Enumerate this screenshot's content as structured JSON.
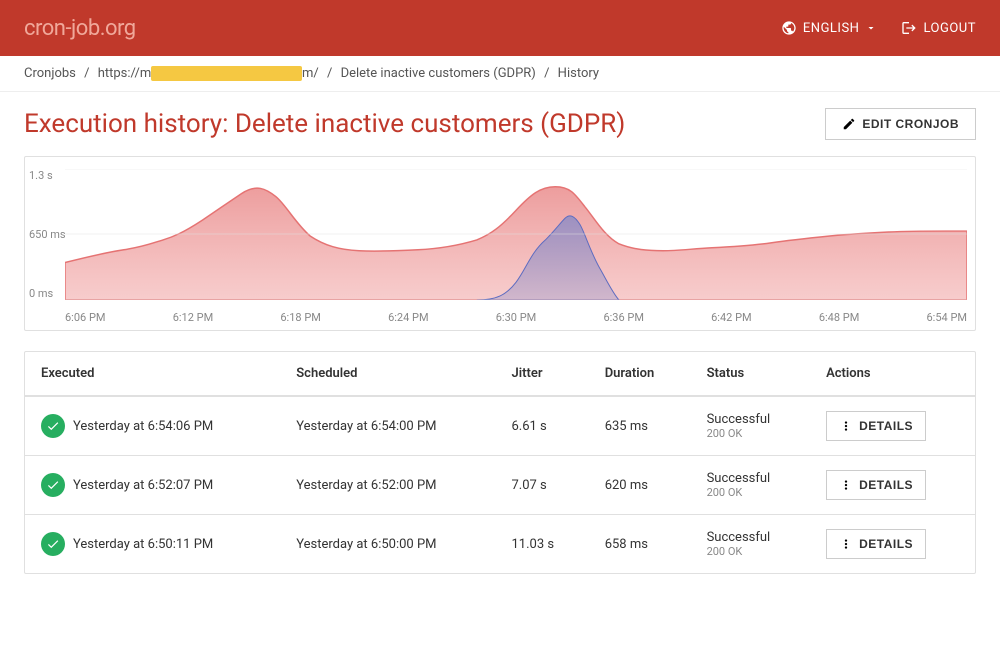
{
  "header": {
    "logo_text": "cron-job",
    "logo_suffix": ".org",
    "lang_label": "ENGLISH",
    "logout_label": "LOGOUT"
  },
  "breadcrumb": {
    "cronjobs": "Cronjobs",
    "url_display": "https://m...m/",
    "job_name": "Delete inactive customers (GDPR)",
    "current": "History"
  },
  "page": {
    "title": "Execution history: Delete inactive customers (GDPR)",
    "edit_btn": "EDIT CRONJOB"
  },
  "chart": {
    "y_labels": [
      "1.3 s",
      "650 ms",
      "0 ms"
    ],
    "x_labels": [
      "6:06 PM",
      "6:12 PM",
      "6:18 PM",
      "6:24 PM",
      "6:30 PM",
      "6:36 PM",
      "6:42 PM",
      "6:48 PM",
      "6:54 PM"
    ]
  },
  "table": {
    "columns": [
      "Executed",
      "Scheduled",
      "Jitter",
      "Duration",
      "Status",
      "Actions"
    ],
    "rows": [
      {
        "executed": "Yesterday at 6:54:06 PM",
        "scheduled": "Yesterday at 6:54:00 PM",
        "jitter": "6.61 s",
        "duration": "635 ms",
        "status": "Successful",
        "status_code": "200 OK",
        "action_label": "DETAILS"
      },
      {
        "executed": "Yesterday at 6:52:07 PM",
        "scheduled": "Yesterday at 6:52:00 PM",
        "jitter": "7.07 s",
        "duration": "620 ms",
        "status": "Successful",
        "status_code": "200 OK",
        "action_label": "DETAILS"
      },
      {
        "executed": "Yesterday at 6:50:11 PM",
        "scheduled": "Yesterday at 6:50:00 PM",
        "jitter": "11.03 s",
        "duration": "658 ms",
        "status": "Successful",
        "status_code": "200 OK",
        "action_label": "DETAILS"
      }
    ]
  }
}
